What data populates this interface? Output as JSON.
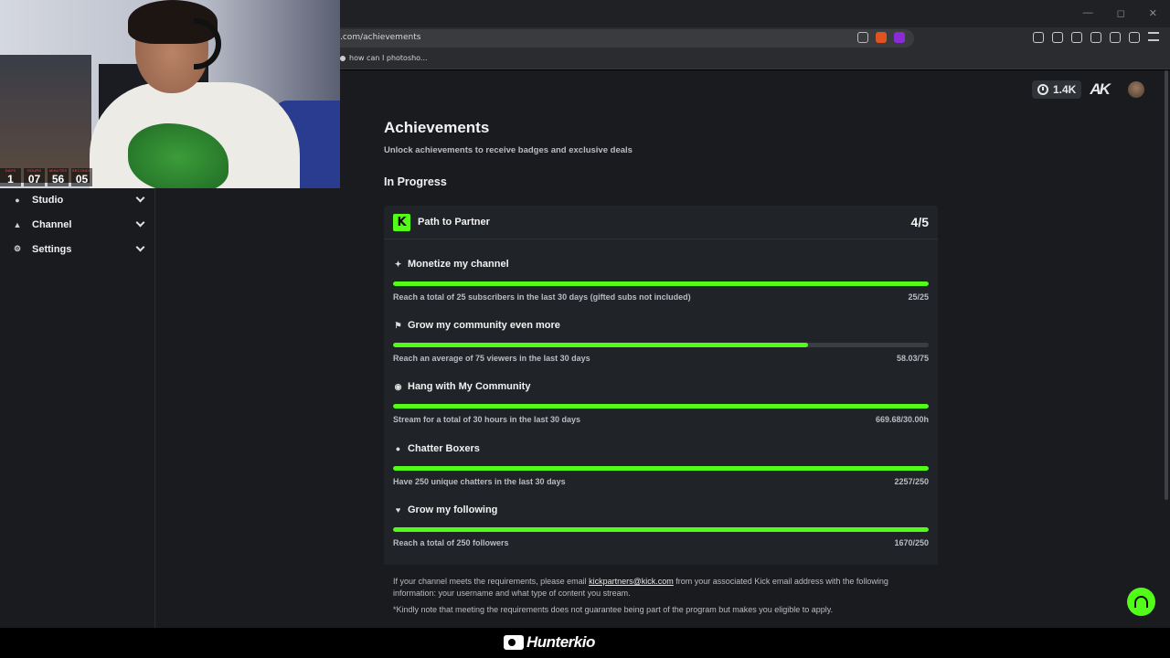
{
  "browser": {
    "url": ".com/achievements",
    "bookmark": "how can I photosho..."
  },
  "header": {
    "kicks_count": "1.4K",
    "logo_text": "AK"
  },
  "webcam": {
    "timer": [
      {
        "label": "DAYS",
        "value": "1"
      },
      {
        "label": "HOURS",
        "value": "07"
      },
      {
        "label": "MINUTES",
        "value": "56"
      },
      {
        "label": "SECONDS",
        "value": "05"
      }
    ]
  },
  "sidebar": {
    "items": [
      {
        "label": "Studio",
        "icon": "studio-icon"
      },
      {
        "label": "Channel",
        "icon": "channel-icon"
      },
      {
        "label": "Settings",
        "icon": "gear-icon"
      }
    ]
  },
  "main": {
    "title": "Achievements",
    "subtitle": "Unlock achievements to receive badges and exclusive deals",
    "section_title": "In Progress",
    "card": {
      "title": "Path to Partner",
      "count": "4/5",
      "goals": [
        {
          "title": "Monetize my channel",
          "icon": "sparkle-icon",
          "desc": "Reach a total of 25 subscribers in the last 30 days (gifted subs not included)",
          "progress_text": "25/25",
          "progress": 1.0
        },
        {
          "title": "Grow my community even more",
          "icon": "community-icon",
          "desc": "Reach an average of 75 viewers in the last 30 days",
          "progress_text": "58.03/75",
          "progress": 0.774
        },
        {
          "title": "Hang with My Community",
          "icon": "broadcast-icon",
          "desc": "Stream for a total of 30 hours in the last 30 days",
          "progress_text": "669.68/30.00h",
          "progress": 1.0
        },
        {
          "title": "Chatter Boxers",
          "icon": "chat-icon",
          "desc": "Have 250 unique chatters in the last 30 days",
          "progress_text": "2257/250",
          "progress": 1.0
        },
        {
          "title": "Grow my following",
          "icon": "heart-icon",
          "desc": "Reach a total of 250 followers",
          "progress_text": "1670/250",
          "progress": 1.0
        }
      ],
      "footer": {
        "text_before": "If your channel meets the requirements, please email ",
        "email": "kickpartners@kick.com",
        "text_after": " from your associated Kick email address with the following information: your username and what type of content you stream.",
        "note": "*Kindly note that meeting the requirements does not guarantee being part of the program but makes you eligible to apply."
      }
    }
  },
  "brand": {
    "name": "Hunterkio"
  },
  "colors": {
    "accent": "#53fc18",
    "page_bg": "#191b1f",
    "card_bg": "#202327"
  }
}
